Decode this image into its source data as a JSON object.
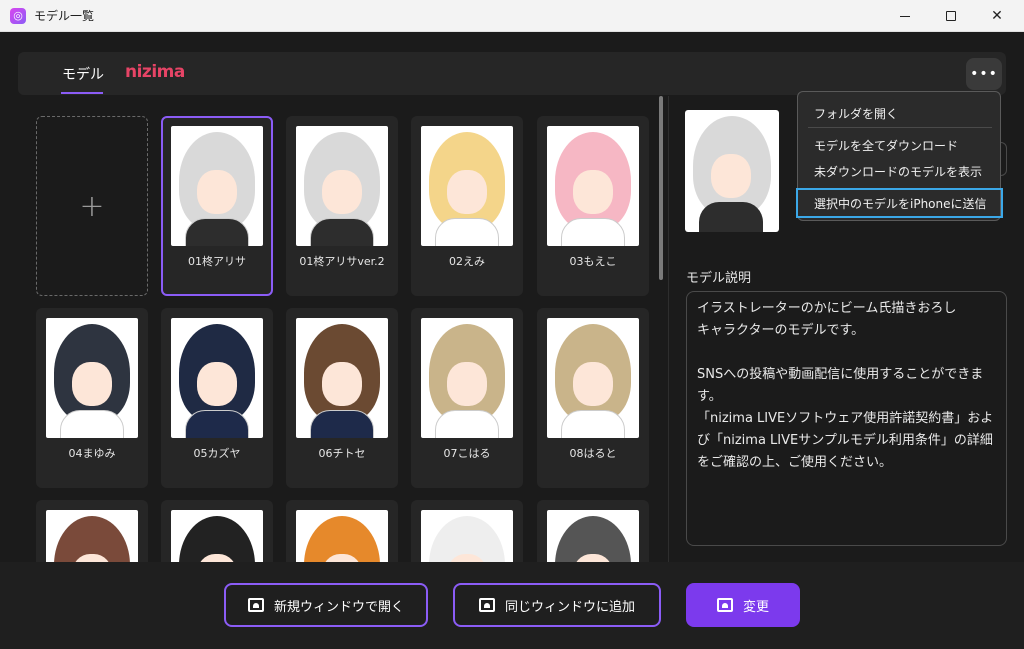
{
  "window": {
    "title": "モデル一覧"
  },
  "header": {
    "tabs": [
      {
        "label": "モデル"
      },
      {
        "label": "nizima"
      }
    ],
    "more_label": "•••"
  },
  "grid": {
    "add_label": "+",
    "models": [
      {
        "name": "01柊アリサ",
        "hair": "#d9d9d9",
        "outfit": "#2d2d2d",
        "selected": true
      },
      {
        "name": "01柊アリサver.2",
        "hair": "#d9d9d9",
        "outfit": "#2d2d2d"
      },
      {
        "name": "02えみ",
        "hair": "#f4d58a",
        "outfit": "#ffffff"
      },
      {
        "name": "03もえこ",
        "hair": "#f6b7c4",
        "outfit": "#ffffff"
      },
      {
        "name": "04まゆみ",
        "hair": "#2e3440",
        "outfit": "#ffffff"
      },
      {
        "name": "05カズヤ",
        "hair": "#1f2a44",
        "outfit": "#1e2a4a"
      },
      {
        "name": "06チトセ",
        "hair": "#6b4a32",
        "outfit": "#1e2a4a"
      },
      {
        "name": "07こはる",
        "hair": "#c9b48a",
        "outfit": "#ffffff"
      },
      {
        "name": "08はると",
        "hair": "#c9b48a",
        "outfit": "#ffffff"
      },
      {
        "name": "",
        "hair": "#7a4a3a",
        "outfit": "#ffffff"
      },
      {
        "name": "",
        "hair": "#222222",
        "outfit": "#ffffff"
      },
      {
        "name": "",
        "hair": "#e6892b",
        "outfit": "#3a2a6a"
      },
      {
        "name": "",
        "hair": "#eeeeee",
        "outfit": "#ffffff"
      },
      {
        "name": "",
        "hair": "#555555",
        "outfit": "#ffffff"
      }
    ]
  },
  "panel": {
    "desc_title": "モデル説明",
    "desc_text": "イラストレーターのかにビーム氏描きおろし\nキャラクターのモデルです。\n\nSNSへの投稿や動画配信に使用することができます。\n「nizima LIVEソフトウェア使用許諾契約書」および「nizima LIVEサンプルモデル利用条件」の詳細をご確認の上、ご使用ください。"
  },
  "menu": {
    "items": [
      {
        "label": "フォルダを開く"
      },
      {
        "label": "モデルを全てダウンロード"
      },
      {
        "label": "未ダウンロードのモデルを表示"
      },
      {
        "label": "選択中のモデルをiPhoneに送信"
      }
    ]
  },
  "footer": {
    "open_new_window": "新規ウィンドウで開く",
    "add_same_window": "同じウィンドウに追加",
    "change": "変更"
  },
  "colors": {
    "accent": "#8b5cf6",
    "highlight": "#3ba8e8",
    "logo": "#e64466"
  }
}
